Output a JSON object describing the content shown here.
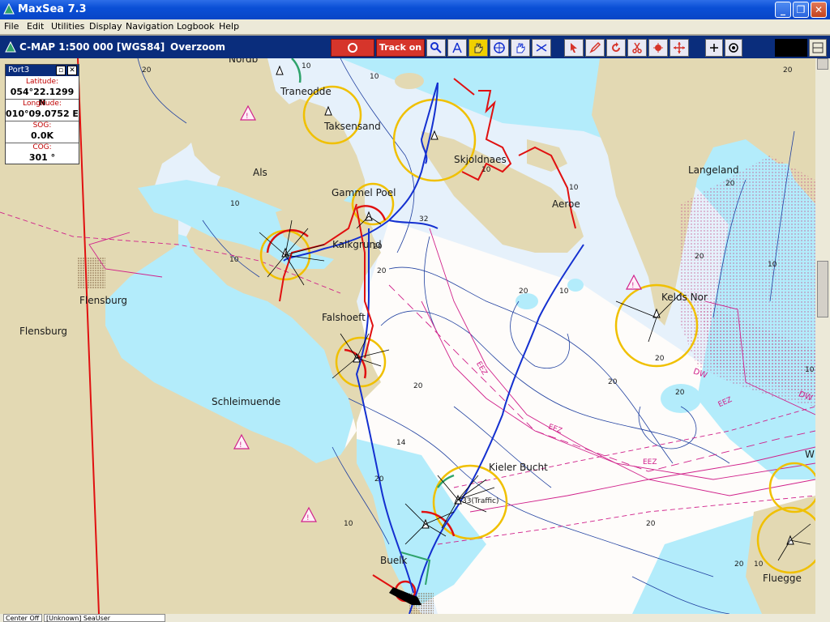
{
  "window": {
    "title": "MaxSea 7.3"
  },
  "menu": [
    "File",
    "Edit",
    "Utilities",
    "Display",
    "Navigation",
    "Logbook",
    "Help"
  ],
  "chart_header": {
    "text": "C-MAP  1:500 000 [WGS84]",
    "zoom_status": "Overzoom"
  },
  "toolbar": {
    "track_label": "Track on",
    "buttons": [
      "stop-record-icon",
      "track-on",
      "zoom-icon",
      "compass-icon",
      "hand-pan-icon",
      "crosshair-icon",
      "grab-icon",
      "measure-icon",
      "cursor-arrow-icon",
      "pencil-icon",
      "rotate-icon",
      "scissors-icon",
      "route-icon",
      "move-icon",
      "plus-icon",
      "target-icon",
      "window-tile-icon"
    ],
    "accent_color": "#d6352b"
  },
  "port_panel": {
    "title": "Port3",
    "latitude_label": "Latitude:",
    "latitude": "054°22.1299 N",
    "longitude_label": "Longitude:",
    "longitude": "010°09.0752 E",
    "sog_label": "SOG:",
    "sog": "0.0K",
    "cog_label": "COG:",
    "cog": "301 °"
  },
  "map_labels": {
    "als": "Als",
    "flensburg1": "Flensburg",
    "flensburg2": "Flensburg",
    "schleimuende": "Schleimuende",
    "taksensand": "Taksensand",
    "traneodde": "Traneodde",
    "gammel_poel": "Gammel Poel",
    "kalkgrund": "Kalkgrund",
    "falshoeft": "Falshoeft",
    "skjoldnaes": "Skjoldnaes",
    "aeroe": "Aeroe",
    "langeland": "Langeland",
    "keldsnor": "Kelds Nor",
    "kieler_bucht": "Kieler Bucht",
    "traffic": "33(Traffic)",
    "buelk": "Buelk",
    "fluegge": "Fluegge",
    "eez1": "EEZ",
    "eez2": "EEZ",
    "eez3": "EEZ",
    "eez4": "EEZ",
    "dw1": "DW",
    "dw2": "DW",
    "w_partial": "W",
    "nordborg_partial": "Nordb"
  },
  "depths": [
    "20",
    "10",
    "10",
    "20",
    "10",
    "20",
    "32",
    "10",
    "20",
    "20",
    "20",
    "20",
    "20",
    "14",
    "20",
    "20",
    "10",
    "10",
    "20",
    "20",
    "10",
    "10",
    "20",
    "20",
    "10",
    "10",
    "10"
  ],
  "status_bar": {
    "left": "Center Off",
    "middle": "[Unknown] SeaUser"
  },
  "colors": {
    "land": "#e3d9b3",
    "shallow": "#b3ecfb",
    "mid": "#e6f1fb",
    "deep": "#fefcfa",
    "track_blue": "#1430d0",
    "track_red": "#e01010",
    "light_yellow": "#f0c000",
    "eez_magenta": "#d0208a"
  }
}
